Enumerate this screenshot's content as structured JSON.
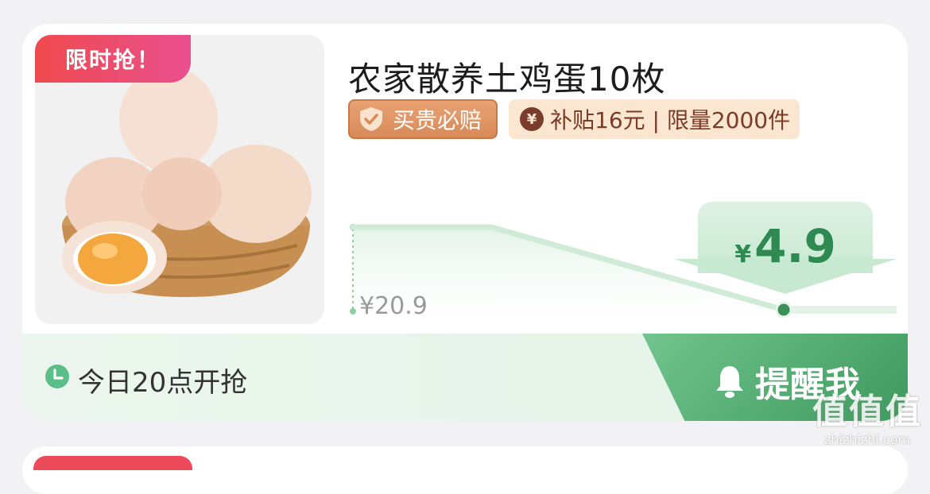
{
  "product": {
    "badge": "限时抢！",
    "title": "农家散养土鸡蛋10枚",
    "image_icon": "eggs-in-basket-image",
    "tags": {
      "guarantee": "买贵必赔",
      "subsidy_symbol": "¥",
      "subsidy": "补贴16元 | 限量2000件"
    }
  },
  "price": {
    "old_price": "¥20.9",
    "currency": "¥",
    "new_price": "4.9",
    "accent_color": "#2e8a50"
  },
  "bottom": {
    "start_time": "今日20点开抢",
    "remind_label": "提醒我"
  },
  "watermark": {
    "logo": "值值值",
    "site": "zhizhizhi.com"
  }
}
